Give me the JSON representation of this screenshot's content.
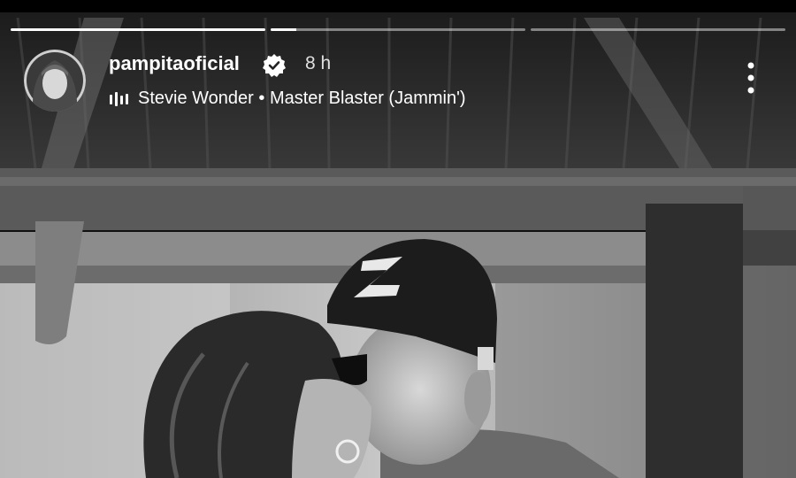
{
  "story": {
    "progress": [
      1,
      0.1,
      0
    ],
    "username": "pampitaoficial",
    "time": "8 h",
    "music": {
      "artist": "Stevie Wonder",
      "separator": " • ",
      "song": "Master Blaster (Jammin')"
    },
    "icons": {
      "verified": "verified-badge-icon",
      "music": "music-bars-icon",
      "more": "more-options-icon"
    }
  }
}
